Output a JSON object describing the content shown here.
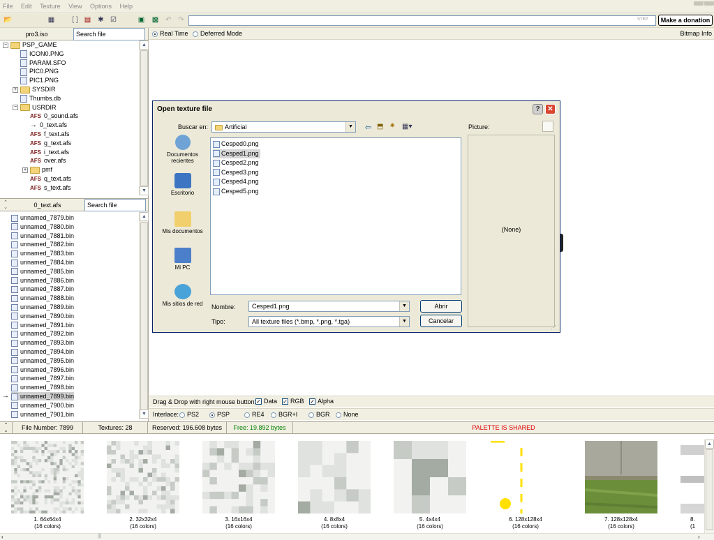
{
  "menu": [
    "File",
    "Edit",
    "Texture",
    "View",
    "Options",
    "Help"
  ],
  "toolbar": {
    "url_value": "",
    "step_label": "STEP",
    "donate_label": "Make a donation"
  },
  "iso_panel": {
    "file_label": "pro3.iso",
    "search_placeholder": "Search file"
  },
  "tree": [
    {
      "label": "PSP_GAME",
      "kind": "folder",
      "level": 0,
      "expander": "−"
    },
    {
      "label": "ICON0.PNG",
      "kind": "file",
      "level": 1
    },
    {
      "label": "PARAM.SFO",
      "kind": "file",
      "level": 1
    },
    {
      "label": "PIC0.PNG",
      "kind": "file",
      "level": 1
    },
    {
      "label": "PIC1.PNG",
      "kind": "file",
      "level": 1
    },
    {
      "label": "SYSDIR",
      "kind": "folder",
      "level": 1,
      "expander": "+"
    },
    {
      "label": "Thumbs.db",
      "kind": "file",
      "level": 1
    },
    {
      "label": "USRDIR",
      "kind": "folder",
      "level": 1,
      "expander": "−"
    },
    {
      "label": "0_sound.afs",
      "kind": "afs",
      "level": 2
    },
    {
      "label": "0_text.afs",
      "kind": "arrow",
      "level": 2
    },
    {
      "label": "f_text.afs",
      "kind": "afs",
      "level": 2
    },
    {
      "label": "g_text.afs",
      "kind": "afs",
      "level": 2
    },
    {
      "label": "i_text.afs",
      "kind": "afs",
      "level": 2
    },
    {
      "label": "over.afs",
      "kind": "afs",
      "level": 2
    },
    {
      "label": "pmf",
      "kind": "folder",
      "level": 2,
      "expander": "+"
    },
    {
      "label": "q_text.afs",
      "kind": "afs",
      "level": 2
    },
    {
      "label": "s_text.afs",
      "kind": "afs",
      "level": 2
    }
  ],
  "afs_panel": {
    "file_label": "0_text.afs",
    "search_placeholder": "Search file"
  },
  "bin_files": [
    "unnamed_7879.bin",
    "unnamed_7880.bin",
    "unnamed_7881.bin",
    "unnamed_7882.bin",
    "unnamed_7883.bin",
    "unnamed_7884.bin",
    "unnamed_7885.bin",
    "unnamed_7886.bin",
    "unnamed_7887.bin",
    "unnamed_7888.bin",
    "unnamed_7889.bin",
    "unnamed_7890.bin",
    "unnamed_7891.bin",
    "unnamed_7892.bin",
    "unnamed_7893.bin",
    "unnamed_7894.bin",
    "unnamed_7895.bin",
    "unnamed_7896.bin",
    "unnamed_7897.bin",
    "unnamed_7898.bin",
    "unnamed_7899.bin",
    "unnamed_7900.bin",
    "unnamed_7901.bin"
  ],
  "selected_bin": "unnamed_7899.bin",
  "mode": {
    "realtime": "Real Time",
    "deferred": "Deferred Mode",
    "bitmap_info": "Bitmap Info"
  },
  "dialog": {
    "title": "Open texture file",
    "lookin_label": "Buscar en:",
    "lookin_value": "Artificial",
    "picture_label": "Picture:",
    "preview_none": "(None)",
    "places": [
      "Documentos recientes",
      "Escritorio",
      "Mis documentos",
      "Mi PC",
      "Mis sitios de red"
    ],
    "files": [
      "Cesped0.png",
      "Cesped1.png",
      "Cesped2.png",
      "Cesped3.png",
      "Cesped4.png",
      "Cesped5.png"
    ],
    "selected_file": "Cesped1.png",
    "name_label": "Nombre:",
    "name_value": "Cesped1.png",
    "type_label": "Tipo:",
    "type_value": "All texture files (*.bmp, *.png, *.tga)",
    "open_label": "Abrir",
    "cancel_label": "Cancelar"
  },
  "dragdrop": {
    "label": "Drag & Drop with right mouse button:",
    "data": "Data",
    "rgb": "RGB",
    "alpha": "Alpha"
  },
  "interlace": {
    "label": "Interlace:",
    "options": [
      "PS2",
      "PSP",
      "RE4",
      "BGR+I",
      "BGR",
      "None"
    ],
    "selected": "PSP"
  },
  "status": {
    "file_number": "File Number: 7899",
    "textures": "Textures: 28",
    "reserved": "Reserved: 196.608 bytes",
    "free": "Free: 19.892 bytes",
    "palette": "PALETTE IS SHARED",
    "free_color": "#008000",
    "palette_color": "#e00000"
  },
  "thumbnails": [
    {
      "title": "1. 64x64x4",
      "sub": "(16 colors)"
    },
    {
      "title": "2. 32x32x4",
      "sub": "(16 colors)"
    },
    {
      "title": "3. 16x16x4",
      "sub": "(16 colors)"
    },
    {
      "title": "4. 8x8x4",
      "sub": "(16 colors)"
    },
    {
      "title": "5. 4x4x4",
      "sub": "(16 colors)"
    },
    {
      "title": "6. 128x128x4",
      "sub": "(16 colors)"
    },
    {
      "title": "7. 128x128x4",
      "sub": "(16 colors)"
    },
    {
      "title": "8.",
      "sub": "(1"
    }
  ]
}
